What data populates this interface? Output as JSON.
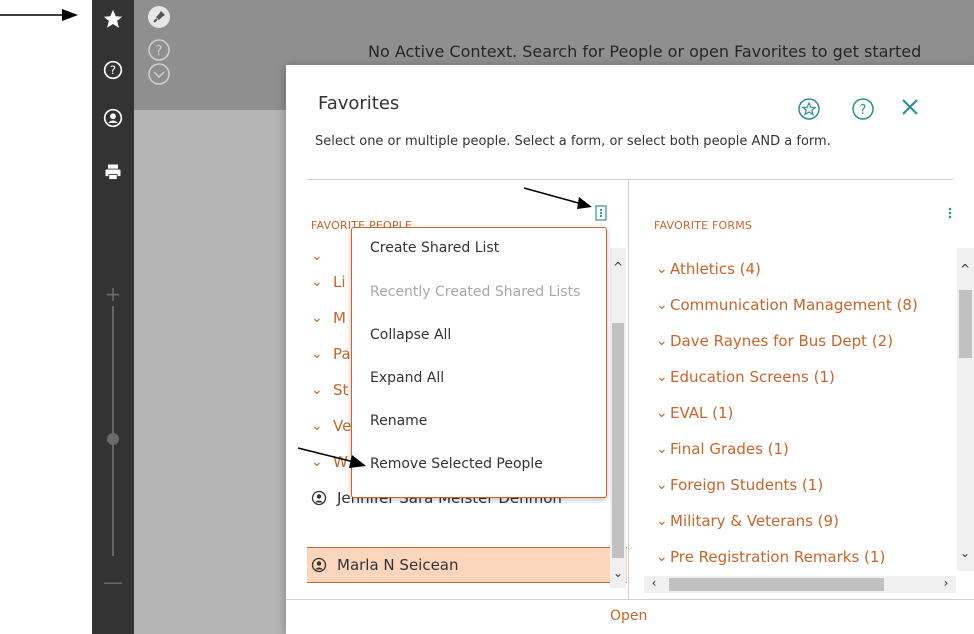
{
  "context": {
    "message": "No Active Context. Search for People or open Favorites to get started"
  },
  "sidebar": {
    "icons": [
      "star-icon",
      "help-icon",
      "user-icon",
      "print-icon"
    ],
    "zoom_plus": "+",
    "zoom_minus": "—"
  },
  "modal": {
    "title": "Favorites",
    "subtitle": "Select one or multiple people. Select a form, or select both people AND a form.",
    "people_header": "FAVORITE PEOPLE",
    "forms_header": "FAVORITE FORMS",
    "open_label": "Open"
  },
  "people": {
    "groups": [
      {
        "label": "Li"
      },
      {
        "label": "M"
      },
      {
        "label": "Pa"
      },
      {
        "label": "St"
      },
      {
        "label": "Ve"
      },
      {
        "label": "W"
      }
    ],
    "persons": [
      {
        "name": "Jennifer Sara Meister Denmon",
        "selected": false
      },
      {
        "name": "Marla N Seicean",
        "selected": true
      }
    ]
  },
  "forms": [
    {
      "label": "Athletics (4)"
    },
    {
      "label": "Communication Management (8)"
    },
    {
      "label": "Dave Raynes for Bus Dept (2)"
    },
    {
      "label": "Education Screens (1)"
    },
    {
      "label": "EVAL (1)"
    },
    {
      "label": "Final Grades (1)"
    },
    {
      "label": "Foreign Students (1)"
    },
    {
      "label": "Military & Veterans (9)"
    },
    {
      "label": "Pre Registration Remarks (1)"
    }
  ],
  "menu": {
    "items": [
      {
        "label": "Create Shared List",
        "enabled": true
      },
      {
        "label": "Recently Created Shared Lists",
        "enabled": false
      },
      {
        "label": "Collapse All",
        "enabled": true
      },
      {
        "label": "Expand All",
        "enabled": true
      },
      {
        "label": "Rename",
        "enabled": true
      },
      {
        "label": "Remove Selected People",
        "enabled": true
      }
    ]
  },
  "colors": {
    "accent": "#c9642a",
    "sidebar": "#333333",
    "selected_row": "#fbd6bd"
  }
}
